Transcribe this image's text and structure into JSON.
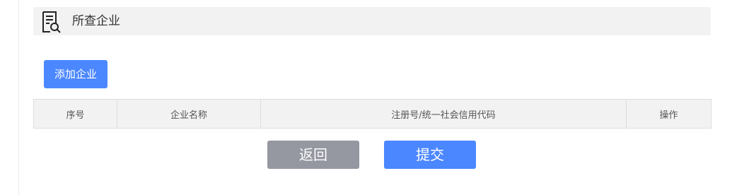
{
  "header": {
    "title": "所查企业",
    "icon": "document-search-icon"
  },
  "add_button_label": "添加企业",
  "table": {
    "columns": [
      "序号",
      "企业名称",
      "注册号/统一社会信用代码",
      "操作"
    ]
  },
  "actions": {
    "back_label": "返回",
    "submit_label": "提交"
  },
  "colors": {
    "primary": "#4b87ff",
    "secondary": "#9597a1",
    "header_bg": "#f2f2f2"
  }
}
